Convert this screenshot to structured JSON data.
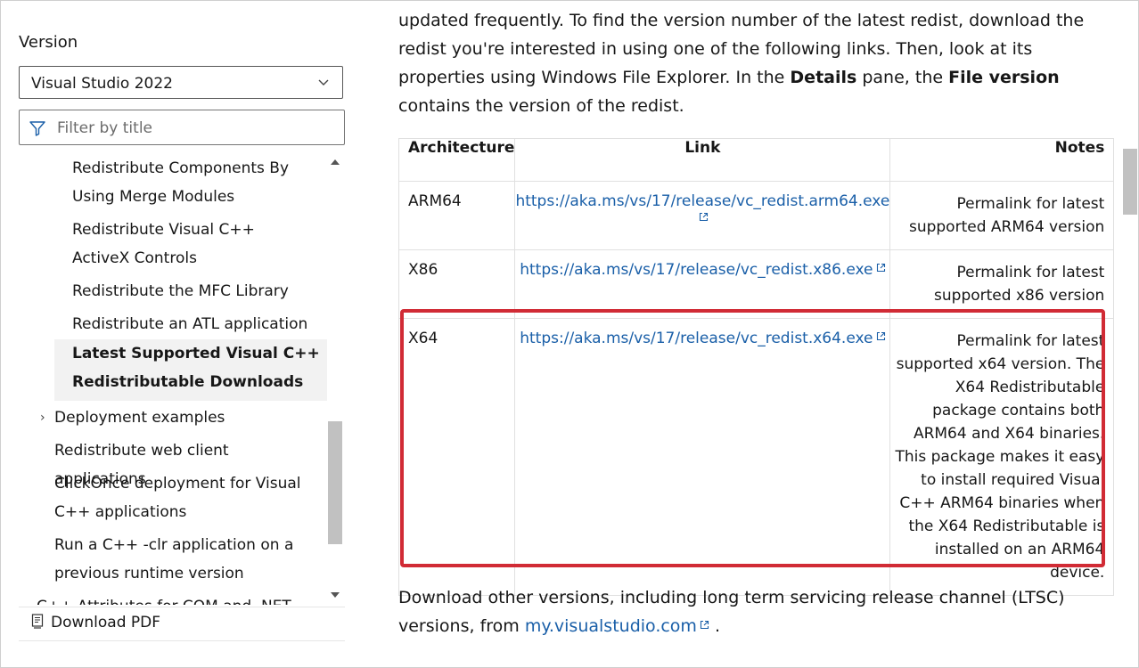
{
  "left_nav": {
    "version_label": "Version",
    "version_value": "Visual Studio 2022",
    "filter_placeholder": "Filter by title",
    "toc": [
      {
        "label": "Redistribute Components By Using Merge Modules"
      },
      {
        "label": "Redistribute Visual C++ ActiveX Controls"
      },
      {
        "label": "Redistribute the MFC Library"
      },
      {
        "label": "Redistribute an ATL application"
      },
      {
        "label": "Latest Supported Visual C++ Redistributable Downloads",
        "active": true
      },
      {
        "label": "Deployment examples",
        "collapsed": true
      },
      {
        "label": "Redistribute web client applications"
      },
      {
        "label": "ClickOnce deployment for Visual C++ applications"
      },
      {
        "label": "Run a C++ -clr application on a previous runtime version"
      },
      {
        "label": "C++ Attributes for COM and .NET"
      }
    ],
    "download_pdf": "Download PDF"
  },
  "main": {
    "intro": {
      "t1": "updated frequently. To find the version number of the latest redist, download the redist you're interested in using one of the following links. Then, look at its properties using Windows File Explorer. In the ",
      "b1": "Details",
      "t2": " pane, the ",
      "b2": "File version",
      "t3": " contains the version of the redist."
    },
    "table": {
      "headers": {
        "architecture": "Architecture",
        "link": "Link",
        "notes": "Notes"
      },
      "rows": [
        {
          "arch": "ARM64",
          "link": "https://aka.ms/vs/17/release/vc_redist.arm64.exe",
          "notes": "Permalink for latest supported ARM64 version"
        },
        {
          "arch": "X86",
          "link": "https://aka.ms/vs/17/release/vc_redist.x86.exe",
          "notes": "Permalink for latest supported x86 version"
        },
        {
          "arch": "X64",
          "link": "https://aka.ms/vs/17/release/vc_redist.x64.exe",
          "notes": "Permalink for latest supported x64 version. The X64 Redistributable package contains both ARM64 and X64 binaries. This package makes it easy to install required Visual C++ ARM64 binaries when the X64 Redistributable is installed on an ARM64 device."
        }
      ]
    },
    "after": {
      "text": "Download other versions, including long term servicing release channel (LTSC) versions, from ",
      "link": "my.visualstudio.com",
      "end": " ."
    }
  },
  "colors": {
    "link": "#1a5fa8",
    "highlight": "#d12b35",
    "active_bg": "#f2f2f2"
  }
}
